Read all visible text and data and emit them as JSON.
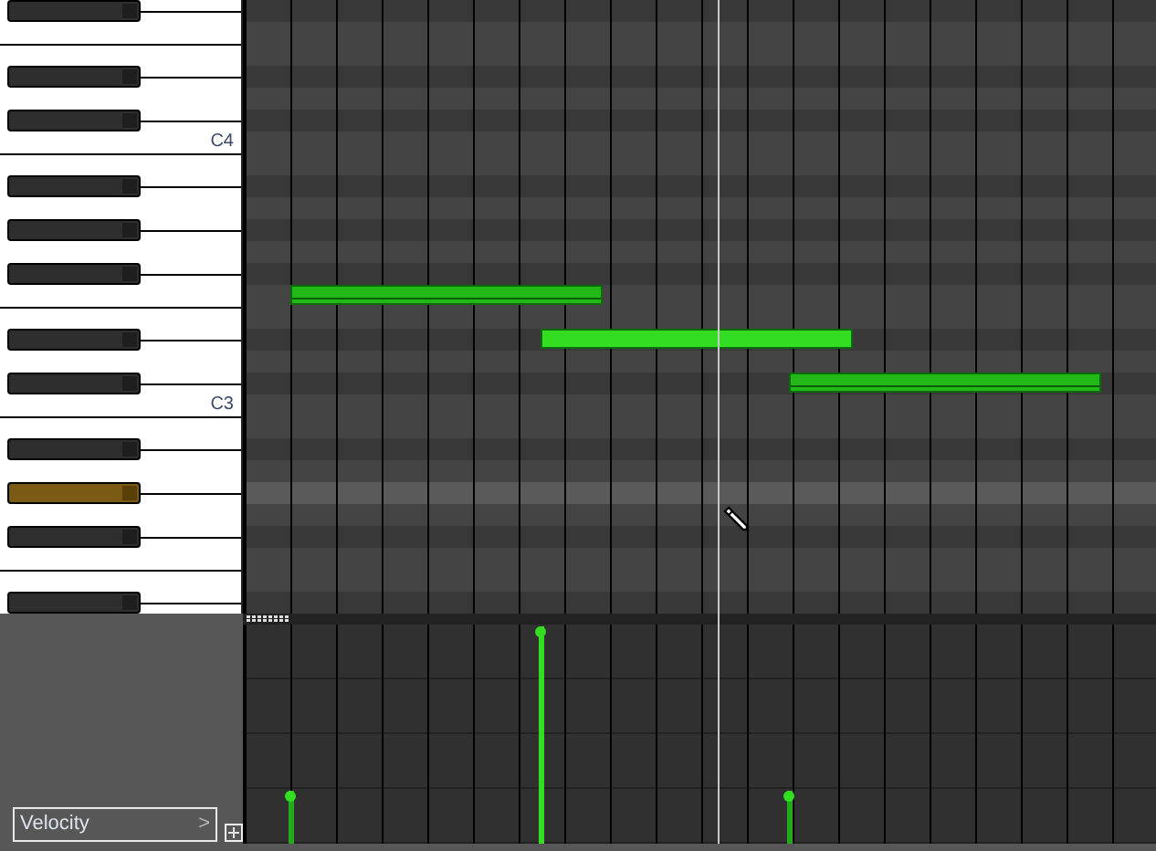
{
  "keyboard": {
    "keys": [
      {
        "kind": "black",
        "pressed": false
      },
      {
        "kind": "white"
      },
      {
        "kind": "white"
      },
      {
        "kind": "black",
        "pressed": false
      },
      {
        "kind": "white"
      },
      {
        "kind": "black",
        "pressed": false
      },
      {
        "kind": "white",
        "label": "C4"
      },
      {
        "kind": "white"
      },
      {
        "kind": "black",
        "pressed": false
      },
      {
        "kind": "white"
      },
      {
        "kind": "black",
        "pressed": false
      },
      {
        "kind": "white"
      },
      {
        "kind": "black",
        "pressed": false
      },
      {
        "kind": "white",
        "notes": [
          {
            "selected": false,
            "level": 0.24
          }
        ]
      },
      {
        "kind": "white"
      },
      {
        "kind": "black",
        "pressed": false,
        "notes": [
          {
            "selected": true,
            "level": 0.99
          }
        ]
      },
      {
        "kind": "white"
      },
      {
        "kind": "black",
        "pressed": false,
        "notes": [
          {
            "selected": false,
            "level": 0.24
          }
        ]
      },
      {
        "kind": "white",
        "label": "C3"
      },
      {
        "kind": "white"
      },
      {
        "kind": "black",
        "pressed": false
      },
      {
        "kind": "white"
      },
      {
        "kind": "black",
        "pressed": true
      },
      {
        "kind": "white"
      },
      {
        "kind": "black",
        "pressed": false
      },
      {
        "kind": "white"
      },
      {
        "kind": "white"
      },
      {
        "kind": "black",
        "pressed": false
      }
    ]
  },
  "controller_lane": {
    "selector": {
      "label": "Velocity",
      "chevron": ">"
    }
  }
}
